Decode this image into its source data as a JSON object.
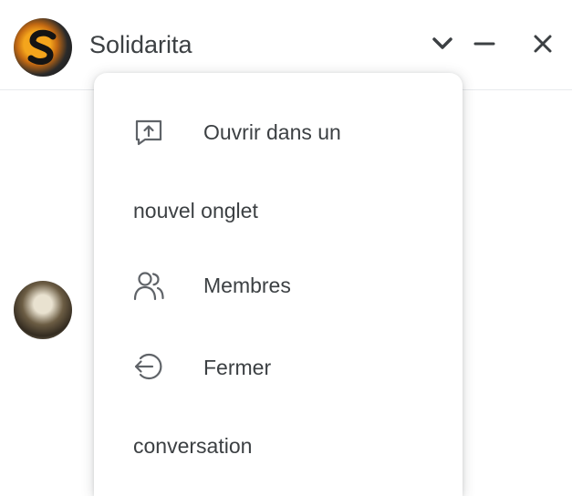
{
  "header": {
    "title": "Solidarita",
    "icons": {
      "logo": "solidarita-logo-icon",
      "expand": "chevron-down-icon",
      "minimize": "minimize-icon",
      "close": "close-icon"
    }
  },
  "menu": {
    "items": [
      {
        "icon": "open-in-new-tab-icon",
        "line1": "Ouvrir dans un",
        "line2": "nouvel onglet"
      },
      {
        "icon": "members-icon",
        "line1": "Membres"
      },
      {
        "icon": "exit-icon",
        "line1": "Fermer",
        "line2": "conversation"
      }
    ]
  },
  "colors": {
    "text": "#3c4043",
    "icon": "#5f6368",
    "divider": "#e8eaed"
  }
}
